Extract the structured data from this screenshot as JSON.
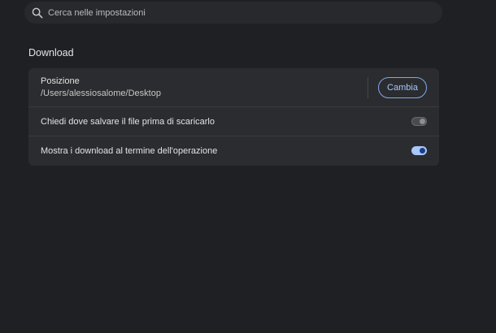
{
  "search": {
    "placeholder": "Cerca nelle impostazioni",
    "icon": "search-icon"
  },
  "downloads": {
    "section_title": "Download",
    "location": {
      "label": "Posizione",
      "path": "/Users/alessiosalome/Desktop",
      "change_button": "Cambia"
    },
    "ask_where": {
      "label": "Chiedi dove salvare il file prima di scaricarlo",
      "enabled": false
    },
    "show_when_done": {
      "label": "Mostra i download al termine dell'operazione",
      "enabled": true
    }
  },
  "colors": {
    "background": "#1f2023",
    "card": "#2b2c2f",
    "accent": "#a8c7fa"
  }
}
